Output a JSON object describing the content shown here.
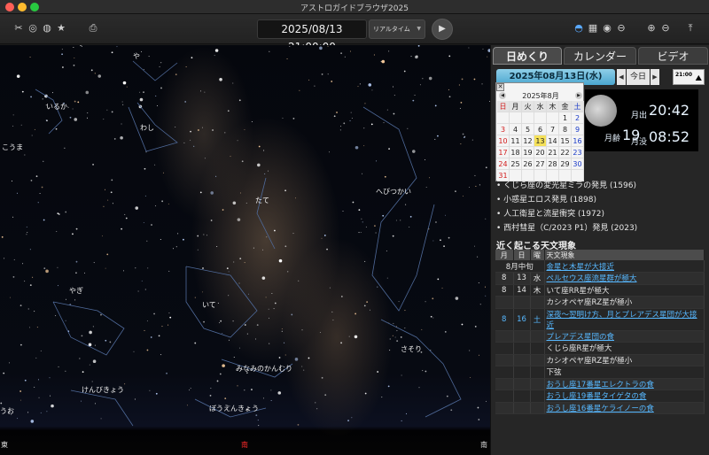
{
  "window": {
    "title": "アストロガイドブラウザ2025"
  },
  "toolbar": {
    "datetime": "2025/08/13 21:00:00",
    "mode": "リアルタイム",
    "left_icons": [
      "scissors-icon",
      "swirl-icon",
      "planet-icon",
      "star-icon",
      "printer-icon"
    ],
    "right_icons": [
      "dome-icon",
      "grid-icon",
      "globe-icon",
      "ring-planet-icon",
      "zoom-in-icon",
      "zoom-out-icon",
      "expand-icon"
    ]
  },
  "sky": {
    "constellations": [
      "や",
      "いるか",
      "わし",
      "こうま",
      "へびつかい",
      "たて",
      "やぎ",
      "いて",
      "さそり",
      "みなみのかんむり",
      "けんびきょう",
      "ぼうえんきょう",
      "うお"
    ],
    "directions": {
      "east": "東",
      "south": "南",
      "west": "南"
    }
  },
  "panel": {
    "tabs": [
      "日めくり",
      "カレンダー",
      "ビデオ"
    ],
    "date": "2025年08月13日(水)",
    "today": "今日",
    "sky_button": "21:00",
    "moon": {
      "age_label": "月齢",
      "age": "19",
      "rise_label": "月出",
      "rise": "20:42",
      "set_label": "月没",
      "set": "08:52"
    },
    "calendar": {
      "close": "✕",
      "month": "2025年8月",
      "weekdays": [
        "日",
        "月",
        "火",
        "水",
        "木",
        "金",
        "土"
      ],
      "days": [
        "",
        "",
        "",
        "",
        "",
        "1",
        "2",
        "3",
        "4",
        "5",
        "6",
        "7",
        "8",
        "9",
        "10",
        "11",
        "12",
        "13",
        "14",
        "15",
        "16",
        "17",
        "18",
        "19",
        "20",
        "21",
        "22",
        "23",
        "24",
        "25",
        "26",
        "27",
        "28",
        "29",
        "30",
        "31",
        "",
        "",
        "",
        "",
        "",
        ""
      ],
      "today": "13"
    },
    "history": [
      "くじら座の変光星ミラの発見 (1596)",
      "小惑星エロス発見 (1898)",
      "人工衛星と流星衝突 (1972)",
      "西村彗星（C/2023 P1）発見 (2023)"
    ],
    "upcoming_title": "近く起こる天文現象",
    "table": {
      "headers": [
        "月",
        "日",
        "曜",
        "天文現象"
      ],
      "rows": [
        {
          "month": "8月中旬",
          "day": "",
          "dow": "",
          "event": "金星と木星が大接近",
          "link": true,
          "span": true
        },
        {
          "month": "8",
          "day": "13",
          "dow": "水",
          "event": "ペルセウス座流星群が極大",
          "link": true
        },
        {
          "month": "8",
          "day": "14",
          "dow": "木",
          "event": "いて座RR星が極大",
          "link": false
        },
        {
          "month": "",
          "day": "",
          "dow": "",
          "event": "カシオペヤ座RZ星が極小",
          "link": false
        },
        {
          "month": "8",
          "day": "16",
          "dow": "土",
          "event": "深夜～翌明け方、月とプレアデス星団が大接近",
          "link": true,
          "hl": true
        },
        {
          "month": "",
          "day": "",
          "dow": "",
          "event": "プレアデス星団の食",
          "link": true
        },
        {
          "month": "",
          "day": "",
          "dow": "",
          "event": "くじら座R星が極大",
          "link": false
        },
        {
          "month": "",
          "day": "",
          "dow": "",
          "event": "カシオペヤ座RZ星が極小",
          "link": false
        },
        {
          "month": "",
          "day": "",
          "dow": "",
          "event": "下弦",
          "link": false
        },
        {
          "month": "",
          "day": "",
          "dow": "",
          "event": "おうし座17番星エレクトラの食",
          "link": true
        },
        {
          "month": "",
          "day": "",
          "dow": "",
          "event": "おうし座19番星タイゲタの食",
          "link": true
        },
        {
          "month": "",
          "day": "",
          "dow": "",
          "event": "おうし座16番星ケライノーの食",
          "link": true
        }
      ]
    }
  }
}
